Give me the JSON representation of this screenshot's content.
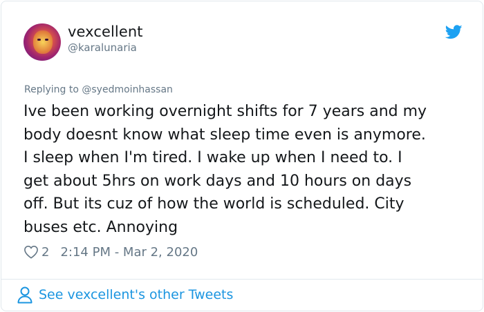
{
  "author": {
    "display_name": "vexcellent",
    "handle": "@karalunaria"
  },
  "tweet": {
    "replying_prefix": "Replying to ",
    "replying_to": "@syedmoinhassan",
    "text": "Ive been working overnight shifts for 7 years and my\nbody doesnt know what sleep time even is anymore.\nI sleep when I'm tired. I wake up when I need to. I\nget about 5hrs on work days and 10 hours on days\noff. But its cuz of how the world is scheduled. City\nbuses etc. Annoying",
    "like_count": "2",
    "timestamp": "2:14 PM - Mar 2, 2020"
  },
  "footer": {
    "see_more_label": "See vexcellent's other Tweets"
  },
  "colors": {
    "accent": "#1da1f2",
    "link": "#1b95e0",
    "muted": "#657786",
    "text": "#14171a"
  },
  "icons": {
    "brand": "twitter-bird-icon",
    "like": "heart-outline-icon",
    "profile": "person-outline-icon"
  }
}
